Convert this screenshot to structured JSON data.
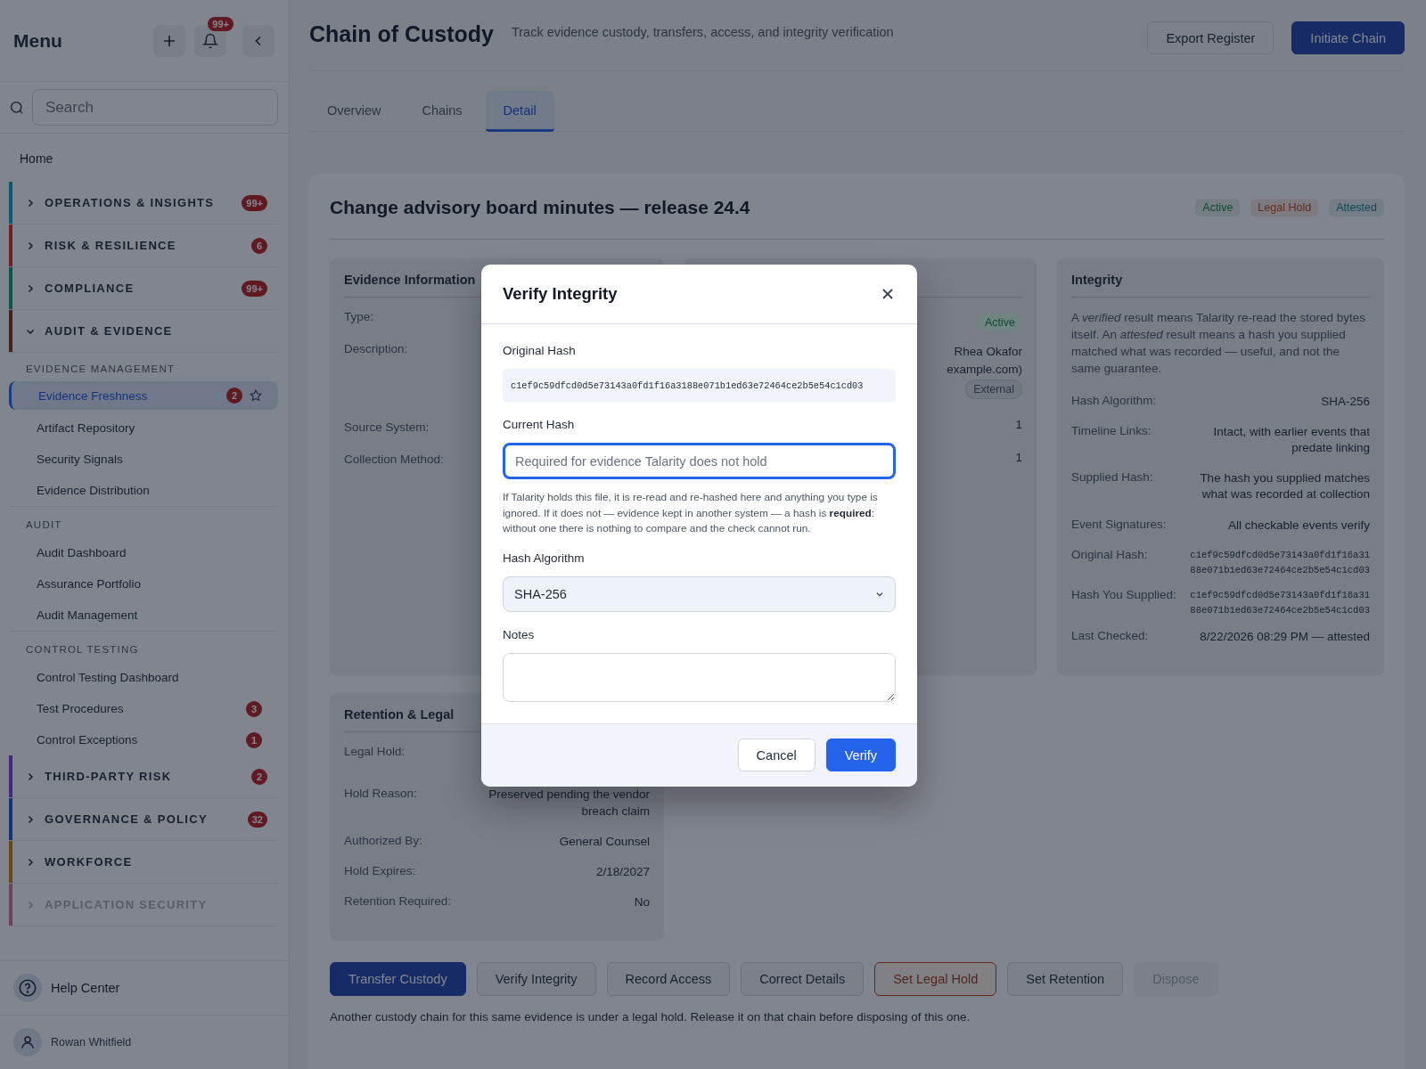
{
  "sidebar": {
    "title": "Menu",
    "notification_count": "99+",
    "search_placeholder": "Search",
    "home": "Home",
    "groups": [
      {
        "label": "OPERATIONS & INSIGHTS",
        "color": "#105871",
        "expanded": false,
        "dimmed": false,
        "badge": "99+"
      },
      {
        "label": "RISK & RESILIENCE",
        "color": "#701f27",
        "expanded": false,
        "dimmed": false,
        "badge": "6"
      },
      {
        "label": "COMPLIANCE",
        "color": "#0b5446",
        "expanded": false,
        "dimmed": false,
        "badge": "99+"
      },
      {
        "label": "AUDIT & EVIDENCE",
        "color": "#43221d",
        "expanded": true,
        "dimmed": false,
        "sections": [
          {
            "heading": "EVIDENCE MANAGEMENT",
            "items": [
              {
                "label": "Evidence Freshness",
                "badge": "2",
                "selected": true
              },
              {
                "label": "Artifact Repository",
                "selected": false
              },
              {
                "label": "Security Signals",
                "selected": false
              },
              {
                "label": "Evidence Distribution",
                "selected": false
              }
            ]
          },
          {
            "heading": "AUDIT",
            "items": [
              {
                "label": "Audit Dashboard",
                "selected": false
              },
              {
                "label": "Assurance Portfolio",
                "selected": false
              },
              {
                "label": "Audit Management",
                "selected": false
              }
            ]
          },
          {
            "heading": "CONTROL TESTING",
            "items": [
              {
                "label": "Control Testing Dashboard",
                "selected": false
              },
              {
                "label": "Test Procedures",
                "badge": "3",
                "selected": false
              },
              {
                "label": "Control Exceptions",
                "badge": "1",
                "selected": false
              }
            ]
          }
        ]
      },
      {
        "label": "THIRD-PARTY RISK",
        "color": "#432884",
        "expanded": false,
        "dimmed": false,
        "badge": "2"
      },
      {
        "label": "GOVERNANCE & POLICY",
        "color": "#17327b",
        "expanded": false,
        "dimmed": false,
        "badge": "32"
      },
      {
        "label": "WORKFORCE",
        "color": "#6f4518",
        "expanded": false,
        "dimmed": false
      },
      {
        "label": "APPLICATION SECURITY",
        "color": "#70425a",
        "expanded": false,
        "dimmed": true
      }
    ],
    "help": "Help Center",
    "user": "Rowan Whitfield"
  },
  "header": {
    "title": "Chain of Custody",
    "subtitle": "Track evidence custody, transfers, access, and integrity verification",
    "actions": [
      {
        "label": "Export Register",
        "kind": "secondary"
      },
      {
        "label": "Initiate Chain",
        "kind": "primary"
      }
    ]
  },
  "tabs": [
    {
      "label": "Overview",
      "selected": false
    },
    {
      "label": "Chains",
      "selected": false
    },
    {
      "label": "Detail",
      "selected": true
    }
  ],
  "record": {
    "title": "Change advisory board minutes — release 24.4",
    "statuses": [
      {
        "label": "Active",
        "color": "#134932"
      },
      {
        "label": "Legal Hold",
        "color": "#642c1b"
      },
      {
        "label": "Attested",
        "color": "#104459"
      }
    ],
    "evidence_info": {
      "title": "Evidence Information",
      "rows": [
        {
          "label": "Type:"
        },
        {
          "label": "Description:"
        },
        {
          "label": "Source System:"
        },
        {
          "label": "Collection Method:"
        }
      ]
    },
    "custody": {
      "rows": [
        {
          "kind": "badge",
          "value": "Active"
        },
        {
          "kind": "person",
          "lines": [
            "Rhea Okafor",
            "example.com)"
          ],
          "tag": "External"
        },
        {
          "kind": "text",
          "value": "1"
        },
        {
          "kind": "text",
          "value": "1"
        }
      ]
    },
    "integrity": {
      "title": "Integrity",
      "intro": "A *verified* result means Talarity re-read the stored bytes itself. An *attested* result means a hash you supplied matched what was recorded — useful, and not the same guarantee.",
      "rows": [
        {
          "label": "Hash Algorithm:",
          "kind": "text",
          "value": "SHA-256"
        },
        {
          "label": "Timeline Links:",
          "kind": "text",
          "value": "Intact, with earlier events that predate linking"
        },
        {
          "label": "Supplied Hash:",
          "kind": "text",
          "value": "The hash you supplied matches what was recorded at collection"
        },
        {
          "label": "Event Signatures:",
          "kind": "text",
          "value": "All checkable events verify"
        },
        {
          "label": "Original Hash:",
          "kind": "mono",
          "value": "c1ef9c59dfcd0d5e73143a0fd1f16a3188e071b1ed63e72464ce2b5e54c1cd03"
        },
        {
          "label": "Hash You Supplied:",
          "kind": "mono",
          "value": "c1ef9c59dfcd0d5e73143a0fd1f16a3188e071b1ed63e72464ce2b5e54c1cd03"
        },
        {
          "label": "Last Checked:",
          "kind": "text",
          "value": "8/22/2026 08:29 PM — attested"
        }
      ]
    },
    "retention": {
      "title": "Retention & Legal",
      "rows": [
        {
          "label": "Legal Hold:"
        },
        {
          "label": "Hold Reason:",
          "value": "Preserved pending the vendor breach claim"
        },
        {
          "label": "Authorized By:",
          "value": "General Counsel"
        },
        {
          "label": "Hold Expires:",
          "value": "2/18/2027"
        },
        {
          "label": "Retention Required:",
          "value": "No"
        }
      ]
    },
    "actions": [
      {
        "label": "Transfer Custody",
        "kind": "primary",
        "disabled": false
      },
      {
        "label": "Verify Integrity",
        "kind": "secondary",
        "disabled": false
      },
      {
        "label": "Record Access",
        "kind": "secondary",
        "disabled": false
      },
      {
        "label": "Correct Details",
        "kind": "secondary",
        "disabled": false
      },
      {
        "label": "Set Legal Hold",
        "kind": "warning",
        "disabled": false
      },
      {
        "label": "Set Retention",
        "kind": "secondary",
        "disabled": false
      },
      {
        "label": "Dispose",
        "kind": "secondary",
        "disabled": true
      }
    ],
    "note": "Another custody chain for this same evidence is under a legal hold. Release it on that chain before disposing of this one."
  },
  "modal": {
    "title": "Verify Integrity",
    "original_hash": {
      "label": "Original Hash",
      "value": "c1ef9c59dfcd0d5e73143a0fd1f16a3188e071b1ed63e72464ce2b5e54c1cd03"
    },
    "current_hash": {
      "label": "Current Hash",
      "placeholder": "Required for evidence Talarity does not hold",
      "focused": true
    },
    "help": "If Talarity holds this file, it is re-read and re-hashed here and anything you type is ignored. If it does not — evidence kept in another system — a hash is **required**: without one there is nothing to compare and the check cannot run.",
    "algorithm": {
      "label": "Hash Algorithm",
      "value": "SHA-256"
    },
    "notes": {
      "label": "Notes"
    },
    "buttons": [
      {
        "label": "Cancel",
        "kind": "secondary"
      },
      {
        "label": "Verify",
        "kind": "primary"
      }
    ]
  }
}
